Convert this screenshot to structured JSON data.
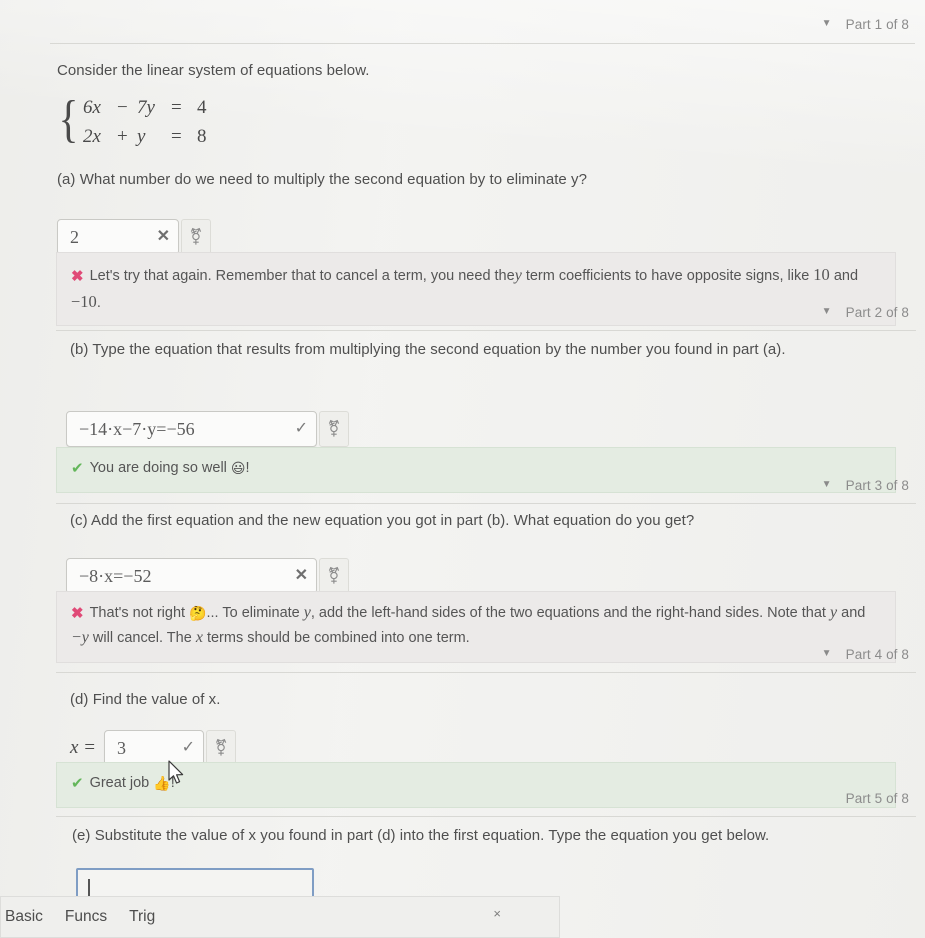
{
  "document": {
    "intro": "Consider the linear system of equations below.",
    "system": {
      "eq1": {
        "term1": "6x",
        "op": "−",
        "term2": "7y",
        "equals": "=",
        "rhs": "4"
      },
      "eq2": {
        "term1": "2x",
        "op": "+",
        "term2": "y",
        "equals": "=",
        "rhs": "8"
      }
    }
  },
  "parts": [
    {
      "header": {
        "caret": "▼",
        "label": "Part 1 of 8"
      },
      "question": "(a) What number do we need to multiply the second equation by to eliminate y?",
      "answer": {
        "value": "2",
        "status": "wrong",
        "status_mark": "✕",
        "keypad_icon": "math-keypad-icon",
        "keypad_glyph": "⚧"
      },
      "feedback": {
        "tone": "negative",
        "icon": "✖",
        "text_before": "Let's try that again. Remember that to cancel a term, you need the",
        "inline_var": "y",
        "text_mid": " term coefficients to have opposite signs, like ",
        "num1": "10",
        "text_and": " and ",
        "num2": "−10",
        "text_end": "."
      }
    },
    {
      "header": {
        "caret": "▼",
        "label": "Part 2 of 8"
      },
      "question": "(b) Type the equation that results from multiplying the second equation by the number you found in part (a).",
      "answer": {
        "value": "−14·x−7·y=−56",
        "status": "right",
        "status_mark": "✓",
        "keypad_icon": "math-keypad-icon",
        "keypad_glyph": "⚧"
      },
      "feedback": {
        "tone": "positive",
        "icon": "✔",
        "text_before": "You are doing so well ",
        "emoji": "😃",
        "text_end": "!"
      }
    },
    {
      "header": {
        "caret": "▼",
        "label": "Part 3 of 8"
      },
      "question": "(c) Add the first equation and the new equation you got in part (b). What equation do you get?",
      "answer": {
        "value": "−8·x=−52",
        "status": "wrong",
        "status_mark": "✕",
        "keypad_icon": "math-keypad-icon",
        "keypad_glyph": "⚧"
      },
      "feedback": {
        "tone": "negative",
        "icon": "✖",
        "text_before": "That's not right ",
        "emoji": "🤔",
        "text_mid": "... To eliminate ",
        "var1": "y",
        "text_2": ", add the left-hand sides of the two equations and the right-hand sides. Note that ",
        "var2": "y",
        "text_3": " and ",
        "var3": "−y",
        "text_4": " will cancel. The ",
        "var4": "x",
        "text_end": " terms should be combined into one term."
      }
    },
    {
      "header": {
        "caret": "▼",
        "label": "Part 4 of 8"
      },
      "question": "(d) Find the value of x.",
      "answer": {
        "prefix": "x =",
        "value": "3",
        "status": "right",
        "status_mark": "✓",
        "keypad_icon": "math-keypad-icon",
        "keypad_glyph": "⚧"
      },
      "feedback": {
        "tone": "positive",
        "icon": "✔",
        "text_before": "Great job ",
        "emoji": "👍",
        "text_end": "!"
      }
    },
    {
      "header": {
        "caret": "",
        "label": "Part 5 of 8"
      },
      "question": "(e) Substitute the value of x you found in part (d) into the first equation. Type the equation you get below.",
      "answer": {
        "value": "",
        "placeholder": "",
        "status": "empty",
        "focused": true
      }
    }
  ],
  "keypad": {
    "tabs": [
      "Basic",
      "Funcs",
      "Trig"
    ],
    "close_label": "×"
  },
  "colors": {
    "page_bg": "#f1f1ef",
    "positive_bg": "#e4ece2",
    "negative_bg": "#eceae9",
    "error_icon": "#e04a77",
    "success_icon": "#63b65a",
    "focus_border": "#7f9dc4",
    "text": "#4f4f4f",
    "muted": "#8f8f8f"
  }
}
